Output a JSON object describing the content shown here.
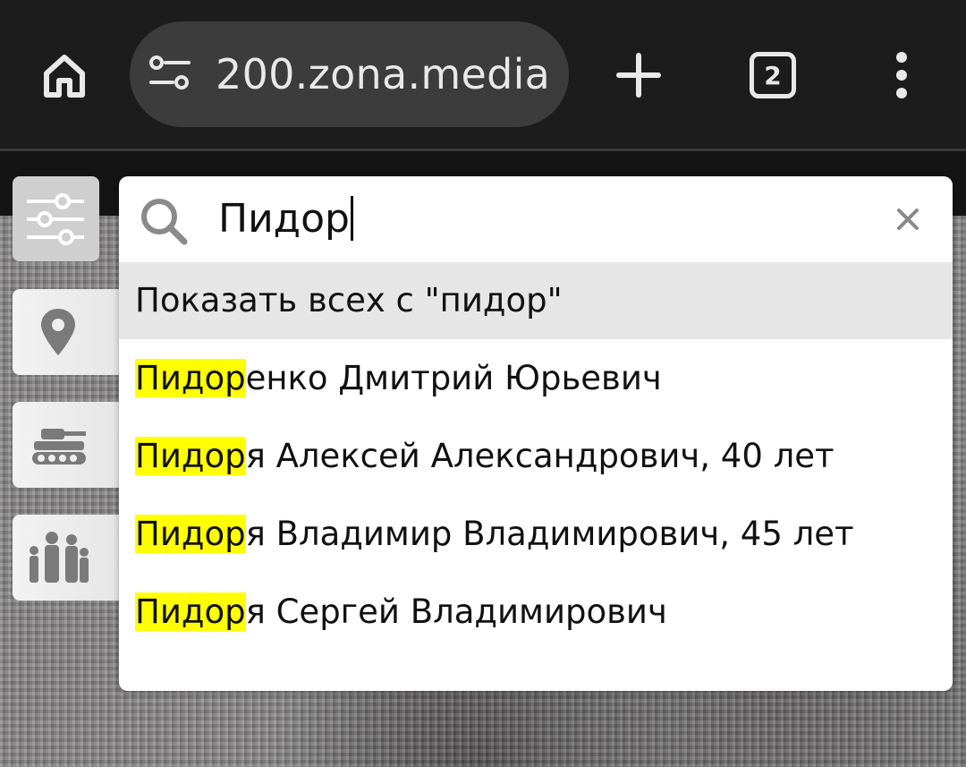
{
  "browser": {
    "url": "200.zona.media",
    "tab_count": "2",
    "icons": {
      "home": "home-icon",
      "site_settings": "tune-icon",
      "new_tab": "plus-icon",
      "tabs": "tab-switcher-icon",
      "menu": "more-vert-icon"
    }
  },
  "sidebar": {
    "items": [
      {
        "name": "filters",
        "icon": "sliders-icon"
      },
      {
        "name": "place",
        "icon": "map-pin-icon"
      },
      {
        "name": "military",
        "icon": "tank-icon"
      },
      {
        "name": "family",
        "icon": "family-icon"
      }
    ]
  },
  "search": {
    "query": "Пидор",
    "show_all_label": "Показать всех с \"пидор\"",
    "results": [
      {
        "match": "Пидор",
        "rest": "енко Дмитрий Юрьевич"
      },
      {
        "match": "Пидор",
        "rest": "я Алексей Александрович, 40 лет"
      },
      {
        "match": "Пидор",
        "rest": "я Владимир Владимирович, 45 лет"
      },
      {
        "match": "Пидор",
        "rest": "я Сергей Владимирович"
      }
    ]
  },
  "colors": {
    "toolbar_bg": "#1c1c1c",
    "omnibox_bg": "#3c3c3c",
    "highlight": "#ffff00",
    "show_all_bg": "#e6e6e6"
  }
}
